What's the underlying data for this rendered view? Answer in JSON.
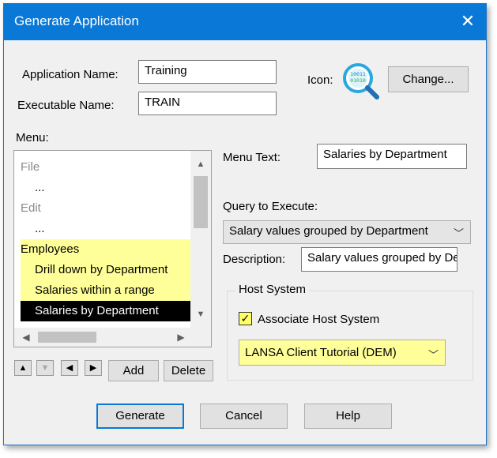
{
  "window": {
    "title": "Generate Application",
    "close_glyph": "✕"
  },
  "app_name": {
    "label": "Application Name:",
    "value": "Training"
  },
  "exe_name": {
    "label": "Executable Name:",
    "value": "TRAIN"
  },
  "icon": {
    "label": "Icon:",
    "change_label": "Change...",
    "icon_name": "query-magnifier-icon"
  },
  "menu": {
    "label": "Menu:",
    "items": [
      {
        "label": "File",
        "style": "gray"
      },
      {
        "label": "...",
        "style": "normal"
      },
      {
        "label": "Edit",
        "style": "gray"
      },
      {
        "label": "...",
        "style": "normal"
      },
      {
        "label": "Employees",
        "style": "highlight"
      },
      {
        "label": "Drill down by Department",
        "style": "highlight"
      },
      {
        "label": "Salaries within a range",
        "style": "highlight"
      },
      {
        "label": "Salaries by Department",
        "style": "selected"
      }
    ],
    "move_buttons": [
      "move-up",
      "move-down",
      "move-left",
      "move-right"
    ],
    "add_label": "Add",
    "delete_label": "Delete"
  },
  "menu_text": {
    "label": "Menu Text:",
    "value": "Salaries by Department"
  },
  "query": {
    "label": "Query to Execute:",
    "value": "Salary values grouped by Department"
  },
  "description": {
    "label": "Description:",
    "value": "Salary values grouped by Department"
  },
  "host_system": {
    "title": "Host System",
    "checkbox_label": "Associate Host System",
    "checked": true,
    "value": "LANSA Client Tutorial (DEM)"
  },
  "buttons": {
    "generate": "Generate",
    "cancel": "Cancel",
    "help": "Help"
  },
  "colors": {
    "titlebar": "#0a78d7",
    "highlight": "#ffff99",
    "selected": "#000000"
  }
}
